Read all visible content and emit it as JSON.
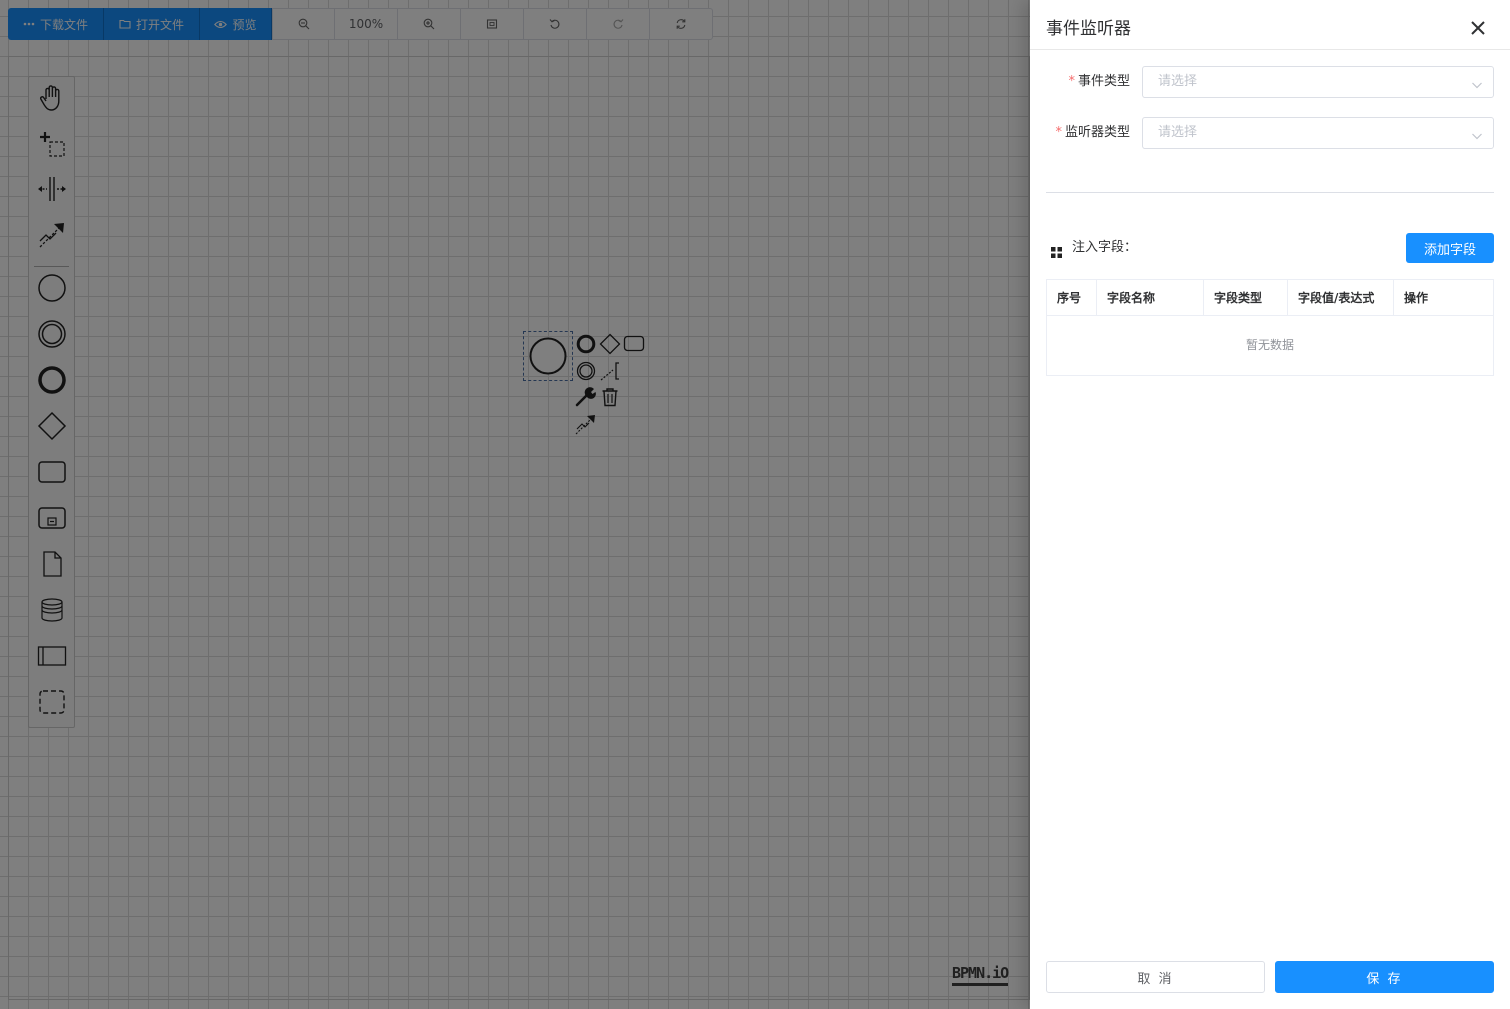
{
  "toolbar": {
    "download_label": "下载文件",
    "open_label": "打开文件",
    "preview_label": "预览",
    "zoom_level": "100%"
  },
  "canvas": {
    "logo_text": "BPMN.iO"
  },
  "drawer": {
    "title": "事件监听器",
    "event_type_label": "事件类型",
    "event_type_placeholder": "请选择",
    "listener_type_label": "监听器类型",
    "listener_type_placeholder": "请选择",
    "fields_title": "注入字段：",
    "add_field_label": "添加字段",
    "table": {
      "columns": [
        "序号",
        "字段名称",
        "字段类型",
        "字段值/表达式",
        "操作"
      ],
      "empty_text": "暂无数据"
    },
    "cancel_label": "取 消",
    "save_label": "保 存"
  },
  "colors": {
    "primary": "#1890ff",
    "required": "#f56c6c"
  }
}
